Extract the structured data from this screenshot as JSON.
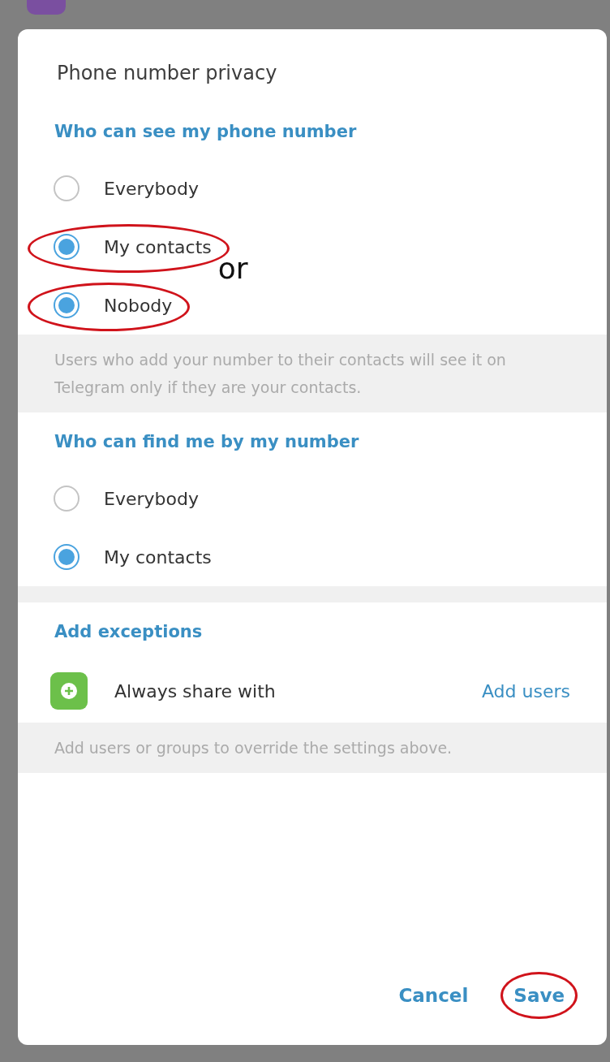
{
  "dialog": {
    "title": "Phone number privacy",
    "sections": [
      {
        "header": "Who can see my phone number",
        "kind": "radio",
        "options": [
          {
            "label": "Everybody",
            "selected": false
          },
          {
            "label": "My contacts",
            "selected": true
          },
          {
            "label": "Nobody",
            "selected": true
          }
        ],
        "note": "Users who add your number to their contacts will see it on Telegram only if they are your contacts."
      },
      {
        "header": "Who can find me by my number",
        "kind": "radio",
        "options": [
          {
            "label": "Everybody",
            "selected": false
          },
          {
            "label": "My contacts",
            "selected": true
          }
        ]
      },
      {
        "header": "Add exceptions",
        "kind": "exceptions",
        "rows": [
          {
            "label": "Always share with",
            "action": "Add users"
          }
        ],
        "note": "Add users or groups to override the settings above."
      }
    ],
    "buttons": [
      "Cancel",
      "Save"
    ]
  },
  "annotations": {
    "or_text": "or"
  }
}
